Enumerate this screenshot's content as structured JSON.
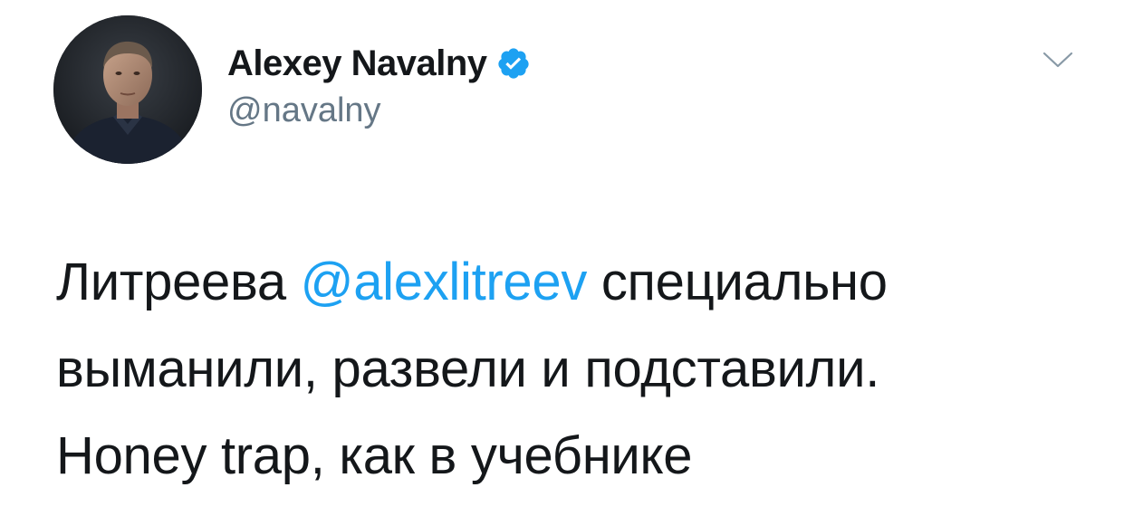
{
  "author": {
    "display_name": "Alexey Navalny",
    "handle": "@navalny",
    "verified": true,
    "verified_icon": "verified-badge-icon"
  },
  "menu": {
    "icon": "chevron-down-icon"
  },
  "tweet": {
    "line1_before": "Литреева ",
    "mention": "@alexlitreev",
    "line1_after": " специально",
    "line2": "выманили, развели и подставили.",
    "line3": "Honey trap, как в учебнике"
  },
  "colors": {
    "text": "#14171a",
    "secondary": "#657786",
    "link": "#1da1f2",
    "verified": "#1da1f2"
  }
}
